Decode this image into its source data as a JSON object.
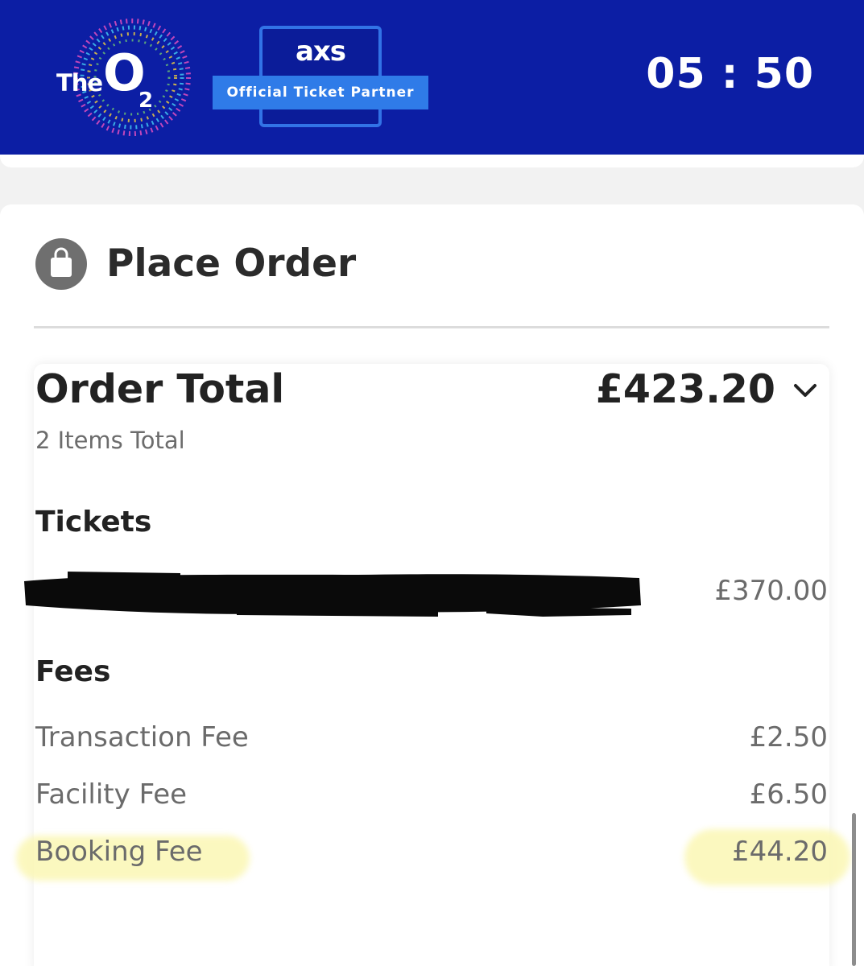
{
  "header": {
    "logo": {
      "the": "The",
      "o": "O",
      "subscript": "2"
    },
    "partner_badge": {
      "brand": "axs",
      "ribbon": "Official Ticket Partner"
    },
    "timer": "05 : 50"
  },
  "place_order": {
    "icon": "shopping-bag-icon",
    "title": "Place Order"
  },
  "order_summary": {
    "total_label": "Order Total",
    "total_amount": "£423.20",
    "expand_icon": "chevron-down-icon",
    "items_total": "2 Items Total",
    "tickets": {
      "heading": "Tickets",
      "item_value": "£370.00"
    },
    "fees": {
      "heading": "Fees",
      "rows": [
        {
          "label": "Transaction Fee",
          "value": "£2.50"
        },
        {
          "label": "Facility Fee",
          "value": "£6.50"
        },
        {
          "label": "Booking Fee",
          "value": "£44.20"
        }
      ]
    }
  },
  "colors": {
    "header_bg": "#0c1ea4",
    "badge_blue": "#2f7be8",
    "highlight": "#fbf7b4"
  }
}
